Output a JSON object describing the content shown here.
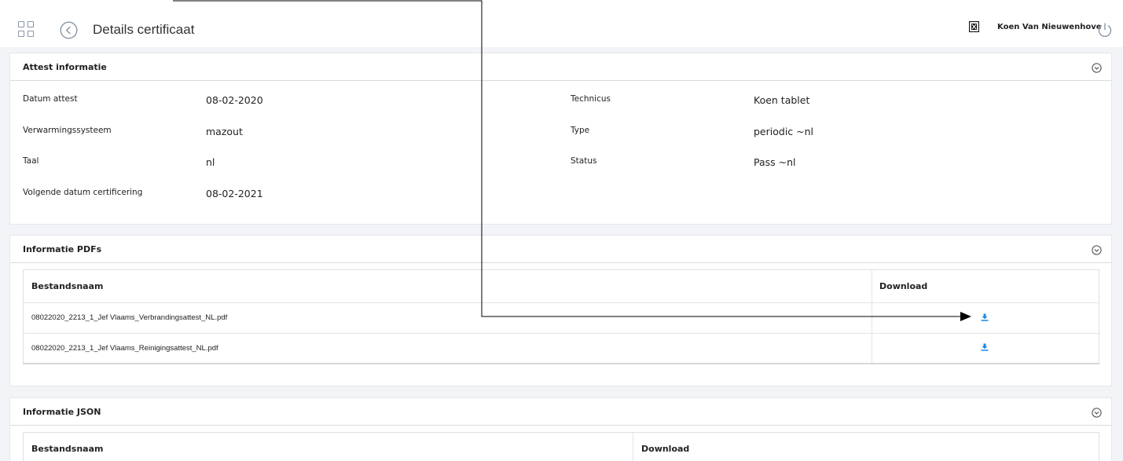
{
  "header": {
    "title": "Details certificaat",
    "user_name": "Koen Van Nieuwenhove"
  },
  "attest": {
    "title": "Attest informatie",
    "fields": [
      {
        "label": "Datum attest",
        "value": "08-02-2020"
      },
      {
        "label": "Verwarmingssysteem",
        "value": "mazout"
      },
      {
        "label": "Taal",
        "value": "nl"
      },
      {
        "label": "Volgende datum certificering",
        "value": "08-02-2021"
      },
      {
        "label": "Technicus",
        "value": "Koen tablet"
      },
      {
        "label": "Type",
        "value": "periodic ~nl"
      },
      {
        "label": "Status",
        "value": "Pass ~nl"
      }
    ]
  },
  "pdfs": {
    "title": "Informatie PDFs",
    "columns": [
      "Bestandsnaam",
      "Download"
    ],
    "rows": [
      {
        "filename": "08022020_2213_1_Jef Vlaams_Verbrandingsattest_NL.pdf",
        "icon": "download-icon"
      },
      {
        "filename": "08022020_2213_1_Jef Vlaams_Reinigingsattest_NL.pdf",
        "icon": "download-icon"
      }
    ]
  },
  "json": {
    "title": "Informatie JSON",
    "columns": [
      "Bestandsnaam",
      "Download"
    ]
  },
  "colors": {
    "accent": "#1e88e5",
    "background": "#f3f4f7",
    "icon_gray": "#8a96a8"
  }
}
